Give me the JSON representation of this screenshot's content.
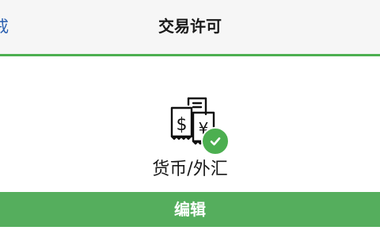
{
  "nav": {
    "back_label": "戒",
    "title": "交易许可"
  },
  "permission": {
    "icon": "money-exchange-icon",
    "status_icon": "check-circle-icon",
    "label": "货币/外汇"
  },
  "actions": {
    "edit_label": "编辑"
  },
  "colors": {
    "accent": "#4caf50",
    "button": "#55ae5d",
    "link": "#2a5fb0",
    "nav_background": "#f6f6f6"
  }
}
